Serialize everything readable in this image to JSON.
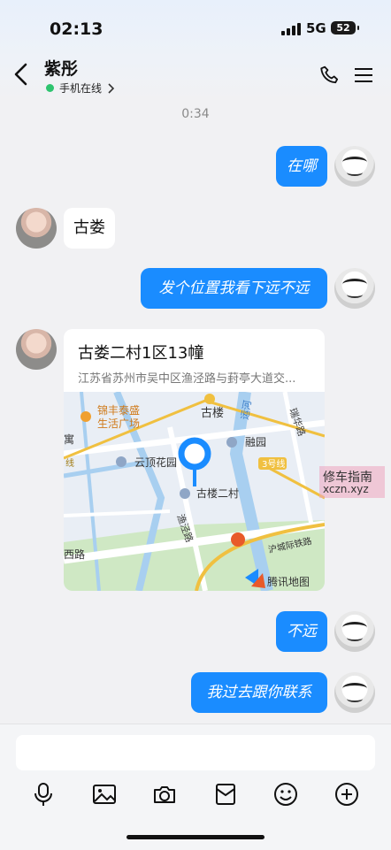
{
  "status": {
    "time": "02:13",
    "network": "5G",
    "battery": "52"
  },
  "header": {
    "contact_name": "紫彤",
    "online_status": "手机在线"
  },
  "timestamp": "0:34",
  "messages": [
    {
      "side": "right",
      "text": "在哪"
    },
    {
      "side": "left",
      "text": "古娄"
    },
    {
      "side": "right",
      "text": "发个位置我看下远不远"
    },
    {
      "side": "left",
      "type": "location",
      "title": "古娄二村1区13幢",
      "address": "江苏省苏州市吴中区渔泾路与葑亭大道交..."
    },
    {
      "side": "right",
      "text": "不远"
    },
    {
      "side": "right",
      "text": "我过去跟你联系"
    }
  ],
  "map": {
    "labels": {
      "mall1": "锦丰泰盛",
      "mall2": "生活广场",
      "gulou": "古楼",
      "river": "运河",
      "ruihua": "瑞华路",
      "yu": "寓",
      "rongyuan": "融园",
      "line": "线",
      "yunding": "云顶花园",
      "line3": "3号线",
      "gulou2": "古楼二村",
      "yujing": "渔泾路",
      "xilu": "西路",
      "railway": "沪城际铁路",
      "brand": "腾讯地图"
    },
    "colors": {
      "water": "#a8cff0",
      "land": "#e9eef5",
      "park": "#cfe8c4",
      "road": "#ffffff",
      "metro": "#f0c040",
      "pin": "#1a8cff"
    }
  },
  "watermark": {
    "line1": "修车指南",
    "line2": "xczn.xyz"
  },
  "toolbar": {
    "items": [
      "microphone-icon",
      "image-icon",
      "camera-icon",
      "red-packet-icon",
      "emoji-icon",
      "plus-icon"
    ]
  }
}
